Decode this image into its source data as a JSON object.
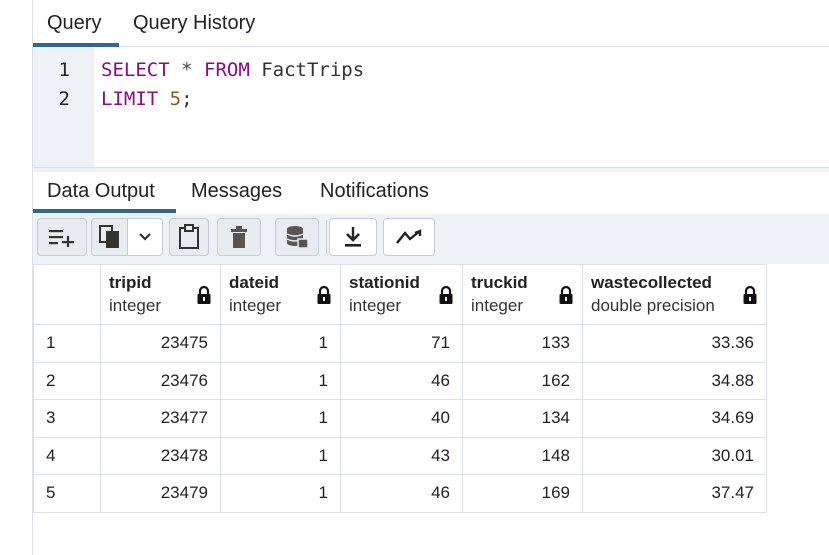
{
  "query_tabs": [
    {
      "label": "Query",
      "active": true
    },
    {
      "label": "Query History",
      "active": false
    }
  ],
  "editor": {
    "lines": [
      {
        "number": "1",
        "tokens": [
          "SELECT",
          "*",
          "FROM",
          "FactTrips"
        ]
      },
      {
        "number": "2",
        "tokens": [
          "LIMIT",
          "5",
          ";"
        ]
      }
    ]
  },
  "output_tabs": [
    {
      "label": "Data Output",
      "active": true
    },
    {
      "label": "Messages",
      "active": false
    },
    {
      "label": "Notifications",
      "active": false
    }
  ],
  "toolbar": {
    "icons": [
      "add-row-icon",
      "copy-icon",
      "chevron-down-icon",
      "paste-icon",
      "delete-icon",
      "save-data-icon",
      "download-icon",
      "graph-icon"
    ]
  },
  "table": {
    "columns": [
      {
        "name": "tripid",
        "type": "integer"
      },
      {
        "name": "dateid",
        "type": "integer"
      },
      {
        "name": "stationid",
        "type": "integer"
      },
      {
        "name": "truckid",
        "type": "integer"
      },
      {
        "name": "wastecollected",
        "type": "double precision"
      }
    ],
    "rows": [
      {
        "n": "1",
        "cells": [
          "23475",
          "1",
          "71",
          "133",
          "33.36"
        ]
      },
      {
        "n": "2",
        "cells": [
          "23476",
          "1",
          "46",
          "162",
          "34.88"
        ]
      },
      {
        "n": "3",
        "cells": [
          "23477",
          "1",
          "40",
          "134",
          "34.69"
        ]
      },
      {
        "n": "4",
        "cells": [
          "23478",
          "1",
          "43",
          "148",
          "30.01"
        ]
      },
      {
        "n": "5",
        "cells": [
          "23479",
          "1",
          "46",
          "169",
          "37.47"
        ]
      }
    ]
  },
  "colors": {
    "accent": "#326690",
    "keyword": "#8b0a8b",
    "number": "#8a5a1e",
    "panel": "#eef1f5"
  }
}
